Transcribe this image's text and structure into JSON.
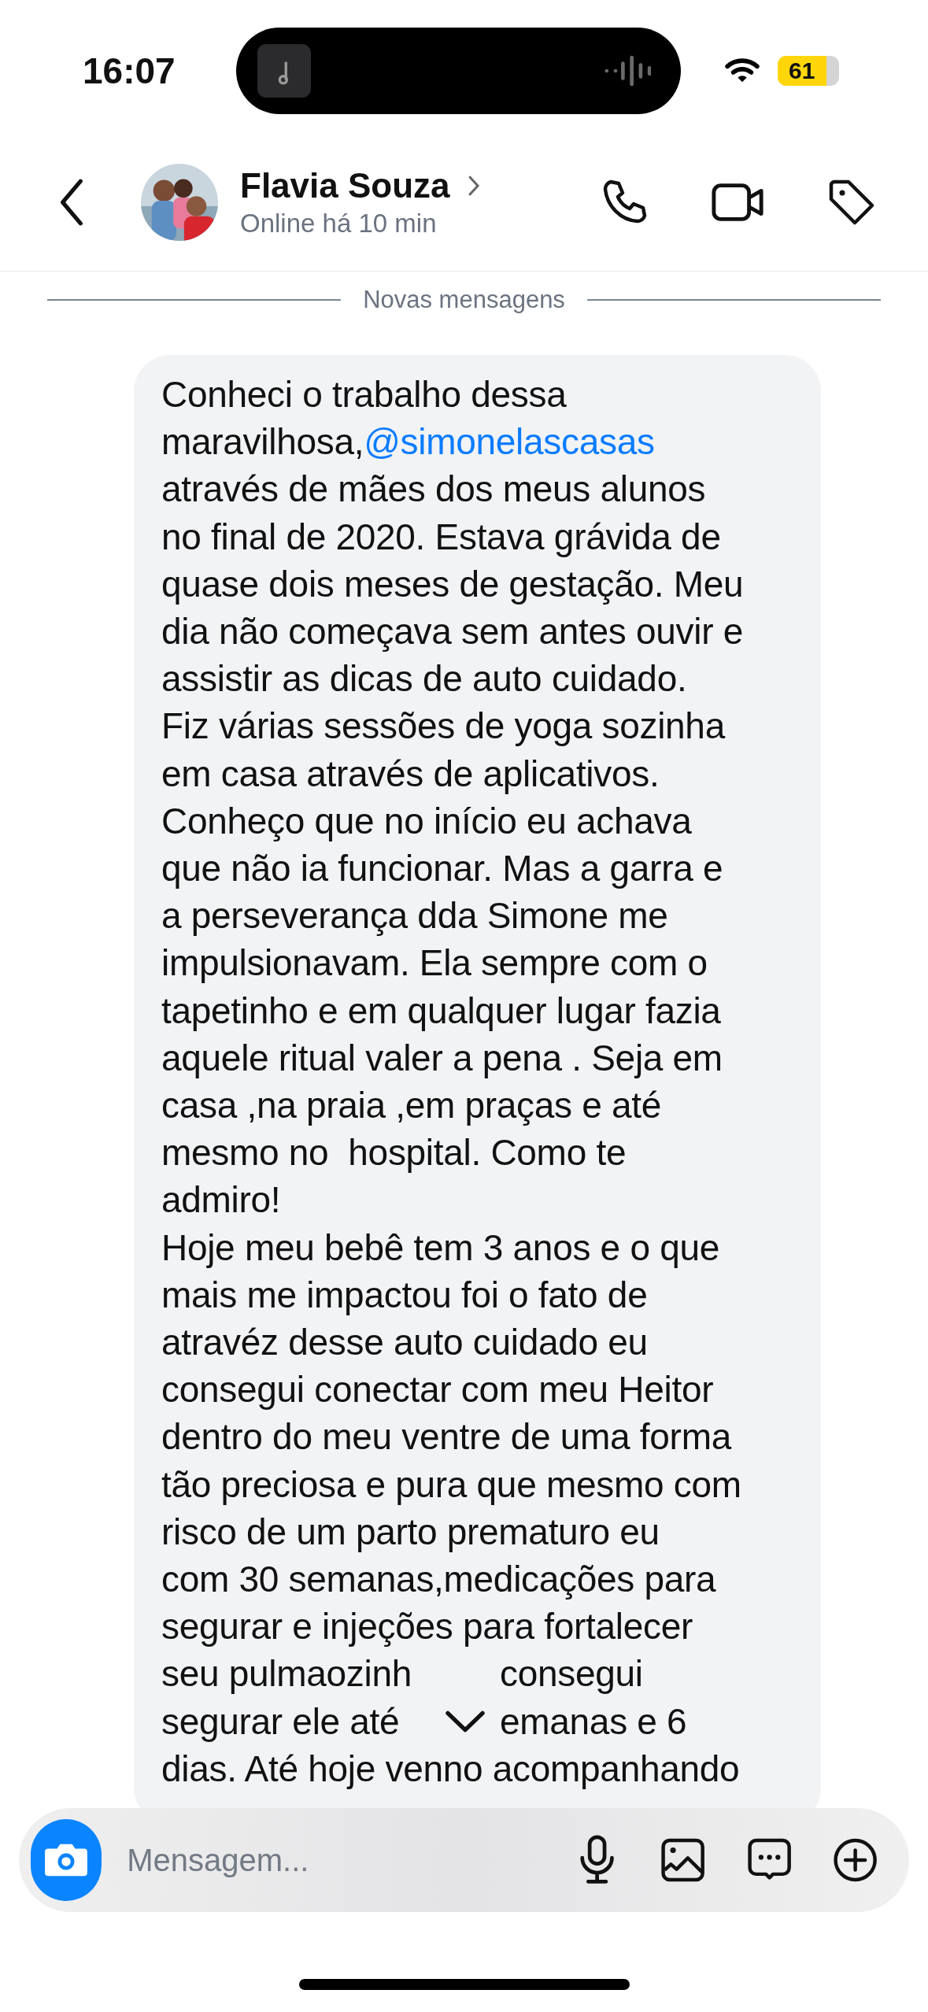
{
  "status_bar": {
    "time": "16:07",
    "battery": "61"
  },
  "header": {
    "name": "Flavia Souza",
    "status": "Online há 10 min"
  },
  "divider": "Novas mensagens",
  "message": {
    "lines": [
      {
        "text": "Conheci o trabalho dessa"
      },
      {
        "text": "maravilhosa,",
        "mention": "@simonelascasas"
      },
      {
        "text": "através de mães dos meus alunos"
      },
      {
        "text": "no final de 2020. Estava grávida de"
      },
      {
        "text": "quase dois meses de gestação. Meu"
      },
      {
        "text": "dia não começava sem antes ouvir e"
      },
      {
        "text": "assistir as dicas de auto cuidado."
      },
      {
        "text": "Fiz várias sessões de yoga sozinha"
      },
      {
        "text": "em casa através de aplicativos."
      },
      {
        "text": "Conheço que no início eu achava"
      },
      {
        "text": "que não ia funcionar. Mas a garra e"
      },
      {
        "text": "a perseverança dda Simone me"
      },
      {
        "text": "impulsionavam. Ela sempre com o"
      },
      {
        "text": "tapetinho e em qualquer lugar fazia"
      },
      {
        "text": "aquele ritual valer a pena . Seja em"
      },
      {
        "text": "casa ,na praia ,em praças e até"
      },
      {
        "text": "mesmo no  hospital. Como te"
      },
      {
        "text": "admiro!"
      },
      {
        "text": "Hoje meu bebê tem 3 anos e o que"
      },
      {
        "text": "mais me impactou foi o fato de"
      },
      {
        "text": "atravéz desse auto cuidado eu"
      },
      {
        "text": "consegui conectar com meu Heitor"
      },
      {
        "text": "dentro do meu ventre de uma forma"
      },
      {
        "text": "tão preciosa e pura que mesmo com"
      },
      {
        "text": "risco de um parto prematuro eu"
      },
      {
        "text": "com 30 semanas,medicações para"
      },
      {
        "text": "segurar e injeções para fortalecer"
      },
      {
        "text": "seu pulmaozinh",
        "after": "consegui"
      },
      {
        "text": "segurar ele até",
        "after": "emanas e 6"
      },
      {
        "text": "dias. Até hoje venno acompanhando"
      }
    ]
  },
  "composer": {
    "placeholder": "Mensagem..."
  }
}
